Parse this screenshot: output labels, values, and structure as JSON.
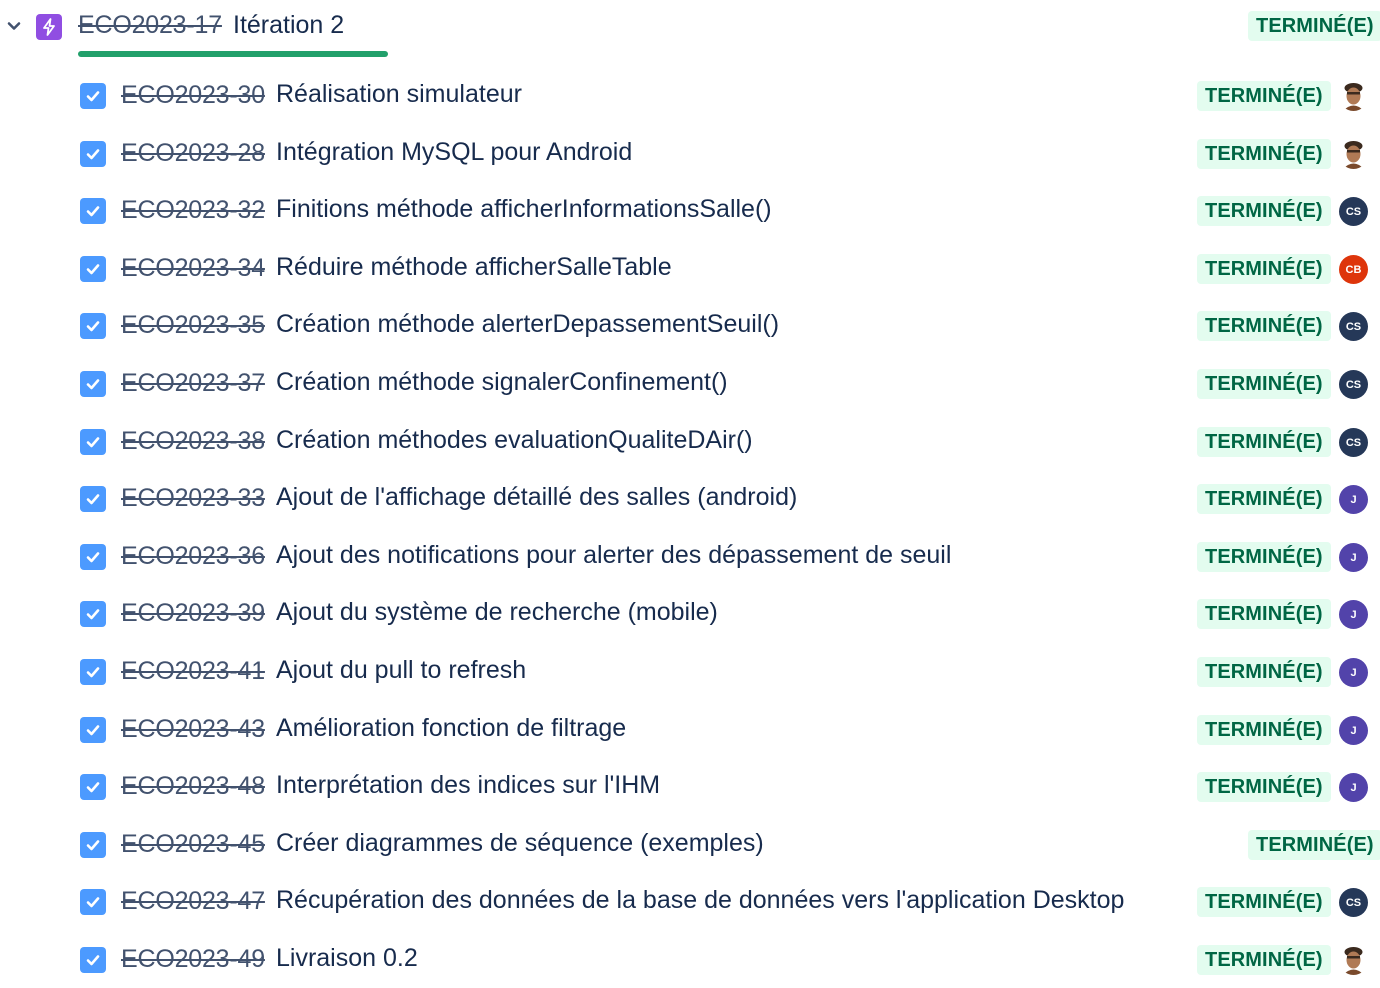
{
  "epic": {
    "key": "ECO2023-17",
    "title": "Itération 2",
    "status": "TERMINÉ(E)",
    "icon": "lightning-icon",
    "progress_done": 1.0
  },
  "colors": {
    "epic_icon": "#904ee2",
    "checkbox": "#4c9aff",
    "status_bg": "#e3fcef",
    "status_text": "#006644",
    "progress": "#22a06b"
  },
  "issues": [
    {
      "key": "ECO2023-30",
      "title": "Réalisation simulateur",
      "status": "TERMINÉ(E)",
      "assignee": "photo",
      "initials": ""
    },
    {
      "key": "ECO2023-28",
      "title": "Intégration MySQL pour Android",
      "status": "TERMINÉ(E)",
      "assignee": "photo",
      "initials": ""
    },
    {
      "key": "ECO2023-32",
      "title": "Finitions méthode afficherInformationsSalle()",
      "status": "TERMINÉ(E)",
      "assignee": "cs",
      "initials": "CS"
    },
    {
      "key": "ECO2023-34",
      "title": "Réduire méthode afficherSalleTable",
      "status": "TERMINÉ(E)",
      "assignee": "cb",
      "initials": "CB"
    },
    {
      "key": "ECO2023-35",
      "title": "Création méthode alerterDepassementSeuil()",
      "status": "TERMINÉ(E)",
      "assignee": "cs",
      "initials": "CS"
    },
    {
      "key": "ECO2023-37",
      "title": "Création méthode signalerConfinement()",
      "status": "TERMINÉ(E)",
      "assignee": "cs",
      "initials": "CS"
    },
    {
      "key": "ECO2023-38",
      "title": "Création méthodes evaluationQualiteDAir()",
      "status": "TERMINÉ(E)",
      "assignee": "cs",
      "initials": "CS"
    },
    {
      "key": "ECO2023-33",
      "title": "Ajout de l'affichage détaillé des salles (android)",
      "status": "TERMINÉ(E)",
      "assignee": "j",
      "initials": "J"
    },
    {
      "key": "ECO2023-36",
      "title": "Ajout des notifications pour alerter des dépassement de seuil",
      "status": "TERMINÉ(E)",
      "assignee": "j",
      "initials": "J"
    },
    {
      "key": "ECO2023-39",
      "title": "Ajout du système de recherche (mobile)",
      "status": "TERMINÉ(E)",
      "assignee": "j",
      "initials": "J"
    },
    {
      "key": "ECO2023-41",
      "title": "Ajout du pull to refresh",
      "status": "TERMINÉ(E)",
      "assignee": "j",
      "initials": "J"
    },
    {
      "key": "ECO2023-43",
      "title": "Amélioration fonction de filtrage",
      "status": "TERMINÉ(E)",
      "assignee": "j",
      "initials": "J"
    },
    {
      "key": "ECO2023-48",
      "title": "Interprétation des indices sur l'IHM",
      "status": "TERMINÉ(E)",
      "assignee": "j",
      "initials": "J"
    },
    {
      "key": "ECO2023-45",
      "title": "Créer diagrammes de séquence (exemples)",
      "status": "TERMINÉ(E)",
      "assignee": "none",
      "initials": ""
    },
    {
      "key": "ECO2023-47",
      "title": "Récupération des données de la base de données vers l'application Desktop",
      "status": "TERMINÉ(E)",
      "assignee": "cs",
      "initials": "CS"
    },
    {
      "key": "ECO2023-49",
      "title": "Livraison 0.2",
      "status": "TERMINÉ(E)",
      "assignee": "photo",
      "initials": ""
    }
  ]
}
